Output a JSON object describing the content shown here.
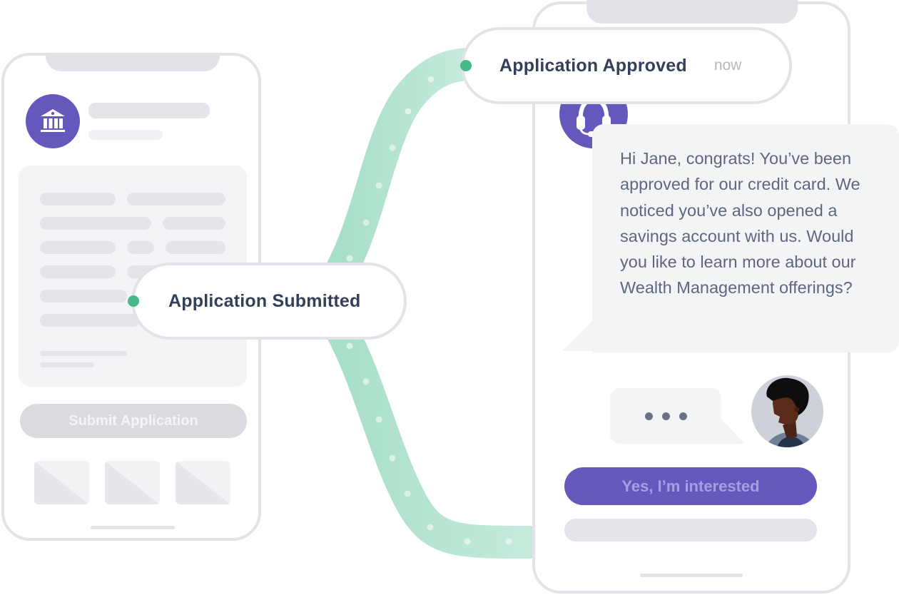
{
  "colors": {
    "brand_purple": "#6558bd",
    "flow_green": "#46b98a",
    "flow_track": "#b3e4d0",
    "phone_border": "#e2e3e9",
    "text_dark": "#33405a",
    "text_muted": "#b4b6c2",
    "chat_text": "#5d6880"
  },
  "left_phone": {
    "avatar_icon": "bank-icon",
    "submit_button_label": "Submit Application",
    "thumbnail_count": 3
  },
  "timeline": {
    "submitted": {
      "title": "Application Submitted"
    },
    "approved": {
      "title": "Application Approved",
      "time": "now"
    }
  },
  "right_phone": {
    "agent_avatar_icon": "headset-icon",
    "agent_message": "Hi Jane, congrats! You’ve been approved for our credit card. We noticed you’ve also opened a savings account with us. Would you like to learn more about our Wealth Management offerings?",
    "typing_indicator_icon": "ellipsis-icon",
    "user_avatar": "user-avatar",
    "primary_button_label": "Yes, I’m interested"
  }
}
